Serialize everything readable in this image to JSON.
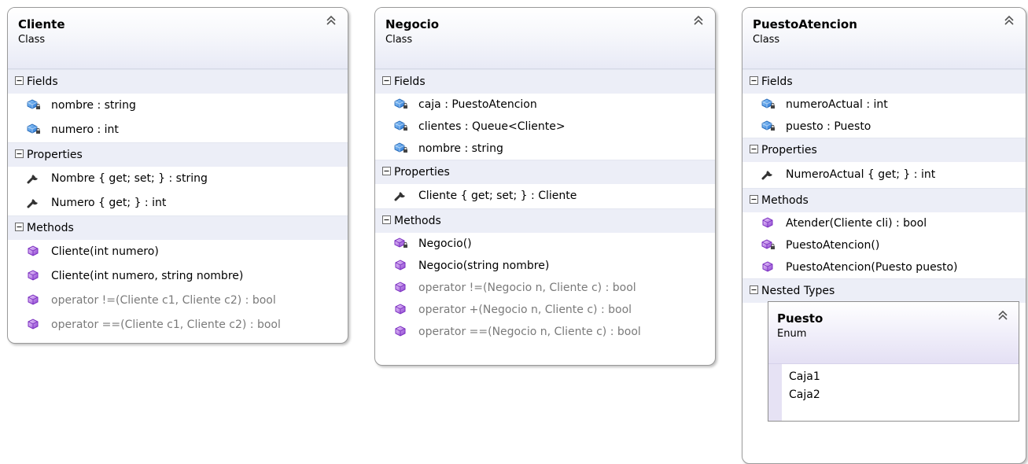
{
  "classes": [
    {
      "name": "Cliente",
      "kind": "Class",
      "sections": [
        {
          "label": "Fields",
          "members": [
            {
              "text": "nombre : string",
              "icon": "private-field-icon"
            },
            {
              "text": "numero : int",
              "icon": "private-field-icon"
            }
          ]
        },
        {
          "label": "Properties",
          "members": [
            {
              "text": "Nombre { get; set; } : string",
              "icon": "property-wrench-icon"
            },
            {
              "text": "Numero { get; } : int",
              "icon": "property-wrench-icon"
            }
          ]
        },
        {
          "label": "Methods",
          "members": [
            {
              "text": "Cliente(int numero)",
              "icon": "method-icon"
            },
            {
              "text": "Cliente(int numero, string nombre)",
              "icon": "method-icon"
            },
            {
              "text": "operator !=(Cliente c1, Cliente c2) : bool",
              "icon": "method-icon",
              "dim": true
            },
            {
              "text": "operator ==(Cliente c1, Cliente c2) : bool",
              "icon": "method-icon",
              "dim": true
            }
          ]
        }
      ]
    },
    {
      "name": "Negocio",
      "kind": "Class",
      "sections": [
        {
          "label": "Fields",
          "members": [
            {
              "text": "caja : PuestoAtencion",
              "icon": "private-field-icon"
            },
            {
              "text": "clientes : Queue<Cliente>",
              "icon": "private-field-icon"
            },
            {
              "text": "nombre : string",
              "icon": "private-field-icon"
            }
          ]
        },
        {
          "label": "Properties",
          "members": [
            {
              "text": "Cliente { get; set; } : Cliente",
              "icon": "property-wrench-icon"
            }
          ]
        },
        {
          "label": "Methods",
          "members": [
            {
              "text": "Negocio()",
              "icon": "private-method-icon"
            },
            {
              "text": "Negocio(string nombre)",
              "icon": "method-icon"
            },
            {
              "text": "operator !=(Negocio n, Cliente c) : bool",
              "icon": "method-icon",
              "dim": true
            },
            {
              "text": "operator +(Negocio n, Cliente c) : bool",
              "icon": "method-icon",
              "dim": true
            },
            {
              "text": "operator ==(Negocio n, Cliente c) : bool",
              "icon": "method-icon",
              "dim": true
            }
          ]
        }
      ]
    },
    {
      "name": "PuestoAtencion",
      "kind": "Class",
      "sections": [
        {
          "label": "Fields",
          "members": [
            {
              "text": "numeroActual : int",
              "icon": "private-field-icon"
            },
            {
              "text": "puesto : Puesto",
              "icon": "private-field-icon"
            }
          ]
        },
        {
          "label": "Properties",
          "members": [
            {
              "text": "NumeroActual { get; } : int",
              "icon": "property-wrench-icon"
            }
          ]
        },
        {
          "label": "Methods",
          "members": [
            {
              "text": "Atender(Cliente cli) : bool",
              "icon": "method-icon"
            },
            {
              "text": "PuestoAtencion()",
              "icon": "private-method-icon"
            },
            {
              "text": "PuestoAtencion(Puesto puesto)",
              "icon": "method-icon"
            }
          ]
        },
        {
          "label": "Nested Types",
          "members": []
        }
      ]
    }
  ],
  "nested_type": {
    "name": "Puesto",
    "kind": "Enum",
    "values": [
      "Caja1",
      "Caja2"
    ]
  },
  "colors": {
    "section_bg": "#eceef7",
    "member_dim": "#7a7a7a",
    "method_purple": "#8a3fd0",
    "field_blue": "#1f6fd0"
  }
}
